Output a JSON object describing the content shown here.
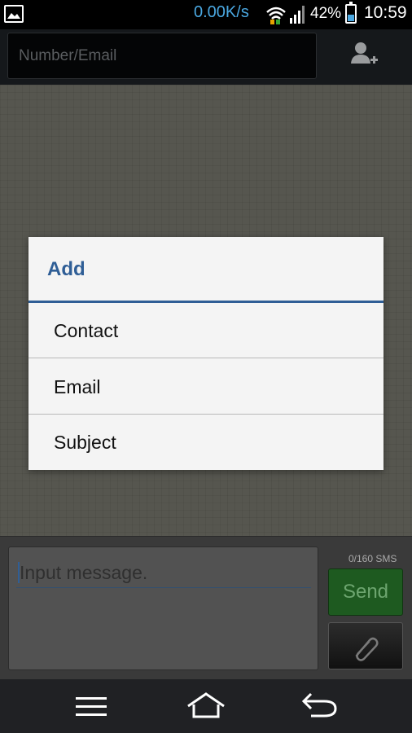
{
  "status_bar": {
    "net_speed": "0.00K/s",
    "battery_percent": "42%",
    "battery_level": 0.42,
    "time": "10:59",
    "accent_color": "#4aa7e0",
    "icons": [
      "gallery-icon",
      "wifi-icon",
      "signal-icon",
      "battery-icon"
    ]
  },
  "recipient": {
    "placeholder": "Number/Email",
    "add_contact_icon": "add-contact-icon"
  },
  "dialog": {
    "title": "Add",
    "options": [
      "Contact",
      "Email",
      "Subject"
    ],
    "accent_color": "#2f5e96"
  },
  "compose": {
    "placeholder": "Input message.",
    "sms_counter": "0/160 SMS",
    "send_label": "Send",
    "attach_icon": "paperclip-icon"
  },
  "nav_bar": {
    "icons": [
      "menu-icon",
      "home-icon",
      "back-icon"
    ]
  }
}
